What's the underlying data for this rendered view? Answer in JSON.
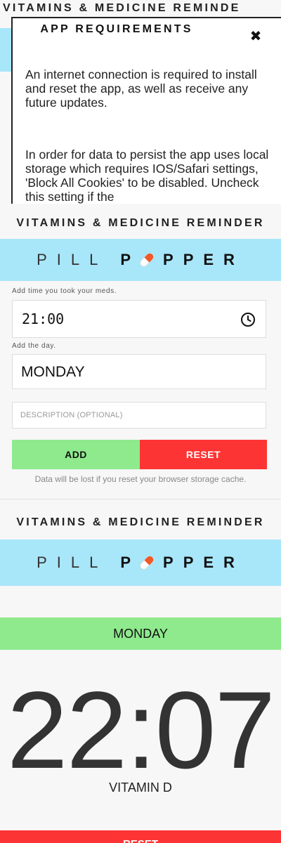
{
  "app": {
    "header": "VITAMINS & MEDICINE REMINDER",
    "header_cropped": "VITAMINS & MEDICINE REMINDE",
    "logo_left": "PILL",
    "logo_right": "PPPER"
  },
  "modal": {
    "title": "APP REQUIREMENTS",
    "close_symbol": "✖",
    "paragraph_1": "An internet connection is required to install and reset the app, as well as receive any future updates.",
    "paragraph_2": "In order for data to persist the app uses local storage which requires IOS/Safari settings, 'Block All Cookies' to be disabled. Uncheck this setting if the"
  },
  "form": {
    "time_label": "Add time you took your meds.",
    "time_value": "21:00",
    "day_label": "Add the day.",
    "day_value": "MONDAY",
    "description_placeholder": "DESCRIPTION (OPTIONAL)",
    "add_button": "ADD",
    "reset_button": "RESET",
    "note": "Data will be lost if you reset your browser storage cache."
  },
  "reminder": {
    "day": "MONDAY",
    "time": "22:07",
    "medicine": "VITAMIN D",
    "reset_button": "RESET"
  },
  "icons": {
    "pill": "pill-capsule-icon",
    "clock": "clock-icon",
    "close": "close-icon"
  },
  "colors": {
    "banner": "#a8e6f9",
    "add_green": "#8eea8c",
    "reset_red": "#fd3434",
    "pill_orange": "#f05a28"
  }
}
